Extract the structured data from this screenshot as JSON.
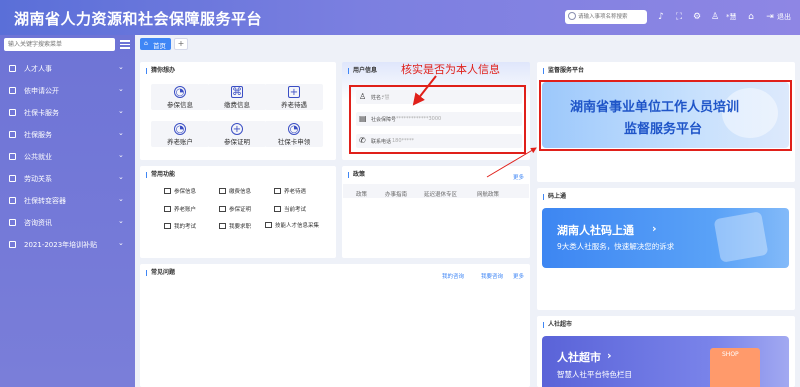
{
  "header": {
    "title": "湖南省人力资源和社会保障服务平台",
    "search_placeholder": "请输入事项名称搜索",
    "user_name": "*慧",
    "logout_label": "退出"
  },
  "sidebar": {
    "search_placeholder": "输入关键字搜索菜单",
    "items": [
      {
        "label": "人才人事"
      },
      {
        "label": "依申请公开"
      },
      {
        "label": "社保卡服务"
      },
      {
        "label": "社保服务"
      },
      {
        "label": "公共就业"
      },
      {
        "label": "劳动关系"
      },
      {
        "label": "社保转变容器"
      },
      {
        "label": "咨询资讯"
      },
      {
        "label": "2021-2023年培训补贴"
      }
    ]
  },
  "tabs": {
    "home_label": "首页",
    "add_label": "+"
  },
  "services": {
    "title": "猜你想办",
    "items": [
      {
        "label": "参保信息"
      },
      {
        "label": "缴费信息"
      },
      {
        "label": "养老待遇"
      },
      {
        "label": "养老账户"
      },
      {
        "label": "参保证明"
      },
      {
        "label": "社保卡申领"
      }
    ]
  },
  "common_functions": {
    "title": "常用功能",
    "items": [
      {
        "label": "参保信息"
      },
      {
        "label": "缴费信息"
      },
      {
        "label": "养老待遇"
      },
      {
        "label": "养老账户"
      },
      {
        "label": "参保证明"
      },
      {
        "label": "当前考试"
      },
      {
        "label": "我的考试"
      },
      {
        "label": "我要求职"
      },
      {
        "label": "技能人才信息采集"
      }
    ]
  },
  "user_info": {
    "title": "用户信息",
    "annotation": "核实是否为本人信息",
    "rows": [
      {
        "label": "姓名：",
        "value": "*慧"
      },
      {
        "label": "社会保障号",
        "value": "*************3000"
      },
      {
        "label": "联系电话",
        "value": "180*****"
      }
    ]
  },
  "policy": {
    "title": "政策",
    "more": "更多",
    "tabs": [
      "政策",
      "办事指南",
      "延迟退休专区",
      "网航政策"
    ]
  },
  "faq": {
    "title": "常见问题",
    "links": [
      "我的咨询",
      "我要咨询",
      "更多"
    ]
  },
  "supervision": {
    "title": "监督服务平台",
    "banner_line1": "湖南省事业单位工作人员培训",
    "banner_line2": "监督服务平台"
  },
  "code_service": {
    "title": "码上通",
    "banner_title": "湖南人社码上通",
    "banner_sub": "9大类人社服务，快速解决您的诉求"
  },
  "mall": {
    "title": "人社超市",
    "banner_title": "人社超市",
    "banner_sub": "智慧人社平台特色栏目",
    "shop_sign": "SHOP"
  },
  "colors": {
    "header_start": "#5a6fd8",
    "accent_blue": "#3f86f5",
    "annotation_red": "#e0201a"
  }
}
